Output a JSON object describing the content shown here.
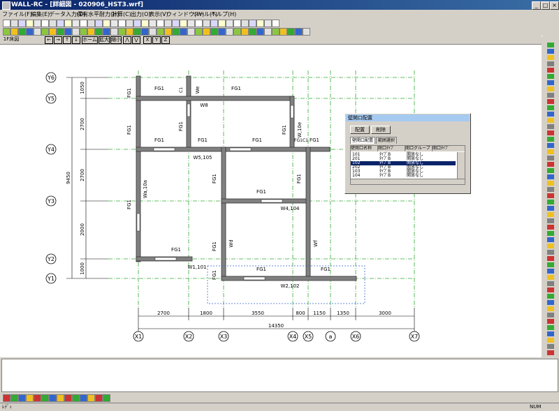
{
  "window": {
    "title": "WALL-RC - [詳細図 - 020906_HST3.wrf]",
    "min": "_",
    "max": "□",
    "close": "×"
  },
  "menu": [
    "ファイル(F)",
    "編集(E)",
    "データ入力(D)",
    "保有水平耐力(H)",
    "計算(C)",
    "出力(O)",
    "表示(V)",
    "ウィンドウ(W)",
    "ツール(T)",
    "ヘルプ(H)"
  ],
  "navbar": {
    "floor": "1F床図",
    "buttons": [
      "←",
      "→",
      "↑",
      "↓",
      "ホーム",
      "拡大",
      "縮小",
      "⋀",
      "⋁",
      "X",
      "Y",
      "Z"
    ]
  },
  "drawing": {
    "dimension_v": {
      "total": "9450",
      "segments": [
        "1050",
        "2700",
        "2700",
        "2000",
        "1000"
      ]
    },
    "dimension_h": {
      "total": "14350",
      "segments": [
        "2700",
        "1800",
        "3550",
        "800",
        "1150",
        "1350",
        "3000"
      ]
    },
    "x_axes": [
      "X1",
      "X2",
      "X3",
      "X4",
      "X5",
      "a",
      "X6",
      "X7"
    ],
    "y_axes": [
      "Y6",
      "Y5",
      "Y4",
      "Y3",
      "Y2",
      "Y1"
    ],
    "labels": {
      "fg1": "FG1",
      "w8": "W8",
      "w5": "W5,105",
      "wa": "Wa,10a",
      "w4": "W4,104",
      "w1": "W1,101",
      "w2": "W2,102",
      "wd": "Wd",
      "wf": "Wf",
      "we": "We",
      "c1": "C1",
      "w10e": "W,10e",
      "fg1c1": "FG1C1"
    }
  },
  "dialog": {
    "title": "壁開口配置",
    "place_button": "配置",
    "delete_button": "削除",
    "tabs": [
      "壁開口配置",
      "範囲選択"
    ],
    "columns": [
      "壁開口名称",
      "開口ﾀｲﾌﾟ",
      "開口グループ",
      "開口ﾀｲﾌﾟ"
    ],
    "rows": [
      [
        "101",
        "ﾀｲﾌﾟB",
        "開放なし"
      ],
      [
        "201",
        "ﾀｲﾌﾟB",
        "開放なし"
      ],
      [
        "102",
        "ﾀｲﾌﾟB",
        "開放なし"
      ],
      [
        "202",
        "ﾀｲﾌﾟB",
        "開放なし"
      ],
      [
        "103",
        "ﾀｲﾌﾟB",
        "開放なし"
      ],
      [
        "104",
        "ﾀｲﾌﾟB",
        "開放なし"
      ]
    ],
    "selected_row": 2
  },
  "status": {
    "left": "ﾚﾃﾞｨ",
    "right": "NUM"
  },
  "colors": {
    "title_start": "#0a246a",
    "title_end": "#3a6ea5",
    "grid": "#33aa33",
    "wall": "#808080",
    "select": "#0a246a",
    "dim": "#000000"
  }
}
